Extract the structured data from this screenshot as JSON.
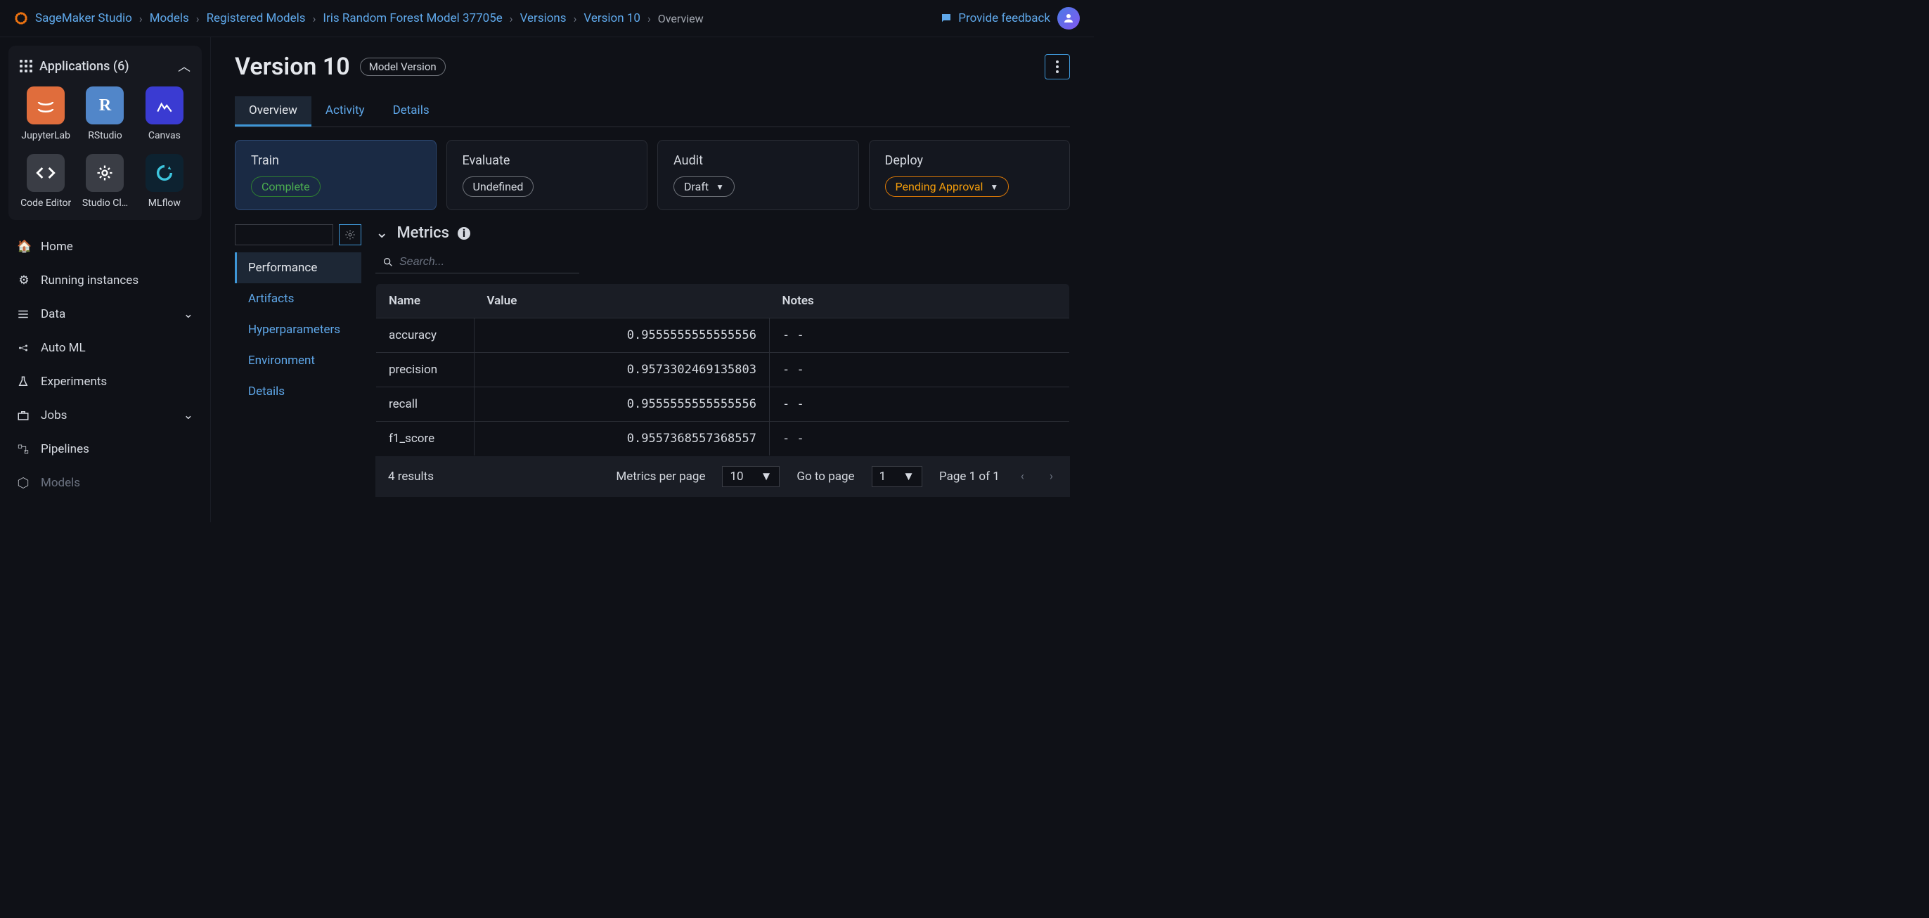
{
  "breadcrumbs": [
    {
      "label": "SageMaker Studio"
    },
    {
      "label": "Models"
    },
    {
      "label": "Registered Models"
    },
    {
      "label": "Iris Random Forest Model 37705e"
    },
    {
      "label": "Versions"
    },
    {
      "label": "Version 10"
    },
    {
      "label": "Overview",
      "current": true
    }
  ],
  "feedback_label": "Provide feedback",
  "sidebar": {
    "apps_header": "Applications (6)",
    "apps": [
      {
        "label": "JupyterLab",
        "color": "orange"
      },
      {
        "label": "RStudio",
        "color": "blue",
        "glyph": "R"
      },
      {
        "label": "Canvas",
        "color": "purple"
      },
      {
        "label": "Code Editor",
        "color": "gray"
      },
      {
        "label": "Studio Cl…",
        "color": "gray"
      },
      {
        "label": "MLflow",
        "color": "dark"
      }
    ],
    "nav": [
      {
        "label": "Home",
        "icon": "home"
      },
      {
        "label": "Running instances",
        "icon": "gear"
      },
      {
        "label": "Data",
        "icon": "stack",
        "expandable": true
      },
      {
        "label": "Auto ML",
        "icon": "automl"
      },
      {
        "label": "Experiments",
        "icon": "flask"
      },
      {
        "label": "Jobs",
        "icon": "briefcase",
        "expandable": true
      },
      {
        "label": "Pipelines",
        "icon": "pipeline"
      },
      {
        "label": "Models",
        "icon": "cube",
        "dim": true
      }
    ]
  },
  "page": {
    "title": "Version 10",
    "badge": "Model Version"
  },
  "tabs": [
    {
      "label": "Overview",
      "active": true
    },
    {
      "label": "Activity"
    },
    {
      "label": "Details"
    }
  ],
  "stages": [
    {
      "title": "Train",
      "status": "Complete",
      "pill": "green",
      "active": true
    },
    {
      "title": "Evaluate",
      "status": "Undefined",
      "pill": "gray"
    },
    {
      "title": "Audit",
      "status": "Draft",
      "pill": "gray",
      "dropdown": true
    },
    {
      "title": "Deploy",
      "status": "Pending Approval",
      "pill": "orange",
      "dropdown": true
    }
  ],
  "subnav": [
    {
      "label": "Performance",
      "active": true
    },
    {
      "label": "Artifacts"
    },
    {
      "label": "Hyperparameters"
    },
    {
      "label": "Environment"
    },
    {
      "label": "Details"
    }
  ],
  "metrics": {
    "section_title": "Metrics",
    "search_placeholder": "Search...",
    "columns": {
      "name": "Name",
      "value": "Value",
      "notes": "Notes"
    },
    "rows": [
      {
        "name": "accuracy",
        "value": "0.9555555555555556",
        "notes": "- -"
      },
      {
        "name": "precision",
        "value": "0.9573302469135803",
        "notes": "- -"
      },
      {
        "name": "recall",
        "value": "0.9555555555555556",
        "notes": "- -"
      },
      {
        "name": "f1_score",
        "value": "0.9557368557368557",
        "notes": "- -"
      }
    ],
    "footer": {
      "results": "4 results",
      "per_page_label": "Metrics per page",
      "per_page_value": "10",
      "goto_label": "Go to page",
      "goto_value": "1",
      "page_info": "Page 1 of 1"
    }
  }
}
